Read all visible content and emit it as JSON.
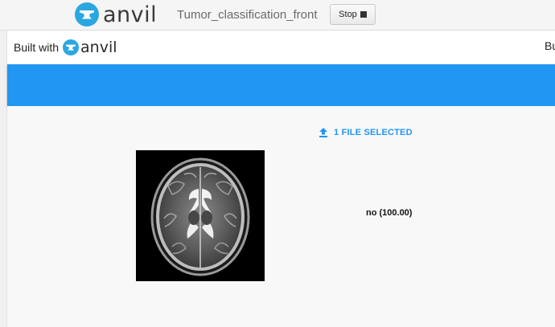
{
  "ide": {
    "brand": "anvil",
    "app_title": "Tumor_classification_front",
    "stop_label": "Stop"
  },
  "app": {
    "built_with_label": "Built with",
    "built_with_brand": "anvil",
    "built_with_truncated": "Bu",
    "file_loader_label": "1 FILE SELECTED",
    "prediction": "no (100.00)"
  },
  "icons": {
    "brand_logo": "anvil-logo-icon",
    "stop": "stop-square-icon",
    "upload": "upload-icon"
  },
  "colors": {
    "accent": "#2196f3",
    "logo_blue": "#2aa7e0",
    "top_bar": "#f5f5f5",
    "content_bg": "#f8f8f8"
  }
}
